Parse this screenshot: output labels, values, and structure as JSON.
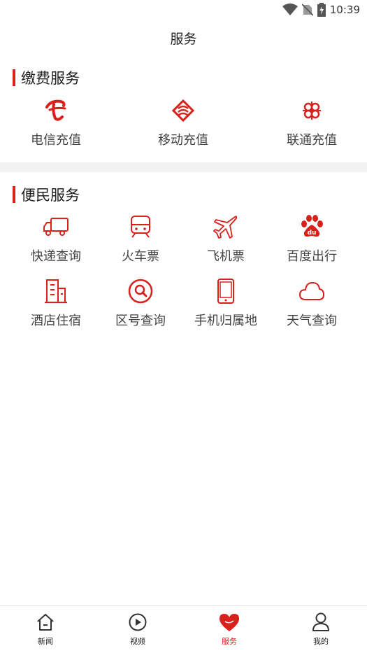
{
  "status_bar": {
    "time": "10:39"
  },
  "header": {
    "title": "服务"
  },
  "payment": {
    "title": "缴费服务",
    "items": [
      {
        "label": "电信充值",
        "icon": "china-telecom-icon"
      },
      {
        "label": "移动充值",
        "icon": "china-mobile-icon"
      },
      {
        "label": "联通充值",
        "icon": "china-unicom-icon"
      }
    ]
  },
  "convenience": {
    "title": "便民服务",
    "items": [
      {
        "label": "快递查询",
        "icon": "truck-icon"
      },
      {
        "label": "火车票",
        "icon": "train-icon"
      },
      {
        "label": "飞机票",
        "icon": "airplane-icon"
      },
      {
        "label": "百度出行",
        "icon": "baidu-icon"
      },
      {
        "label": "酒店住宿",
        "icon": "hotel-icon"
      },
      {
        "label": "区号查询",
        "icon": "search-icon"
      },
      {
        "label": "手机归属地",
        "icon": "phone-icon"
      },
      {
        "label": "天气查询",
        "icon": "cloud-icon"
      }
    ]
  },
  "tabs": [
    {
      "label": "新闻",
      "icon": "home-icon"
    },
    {
      "label": "视频",
      "icon": "play-icon"
    },
    {
      "label": "服务",
      "icon": "heart-icon",
      "active": true
    },
    {
      "label": "我的",
      "icon": "user-icon"
    }
  ],
  "colors": {
    "accent": "#d9201b",
    "divider": "#f2f2f2"
  }
}
